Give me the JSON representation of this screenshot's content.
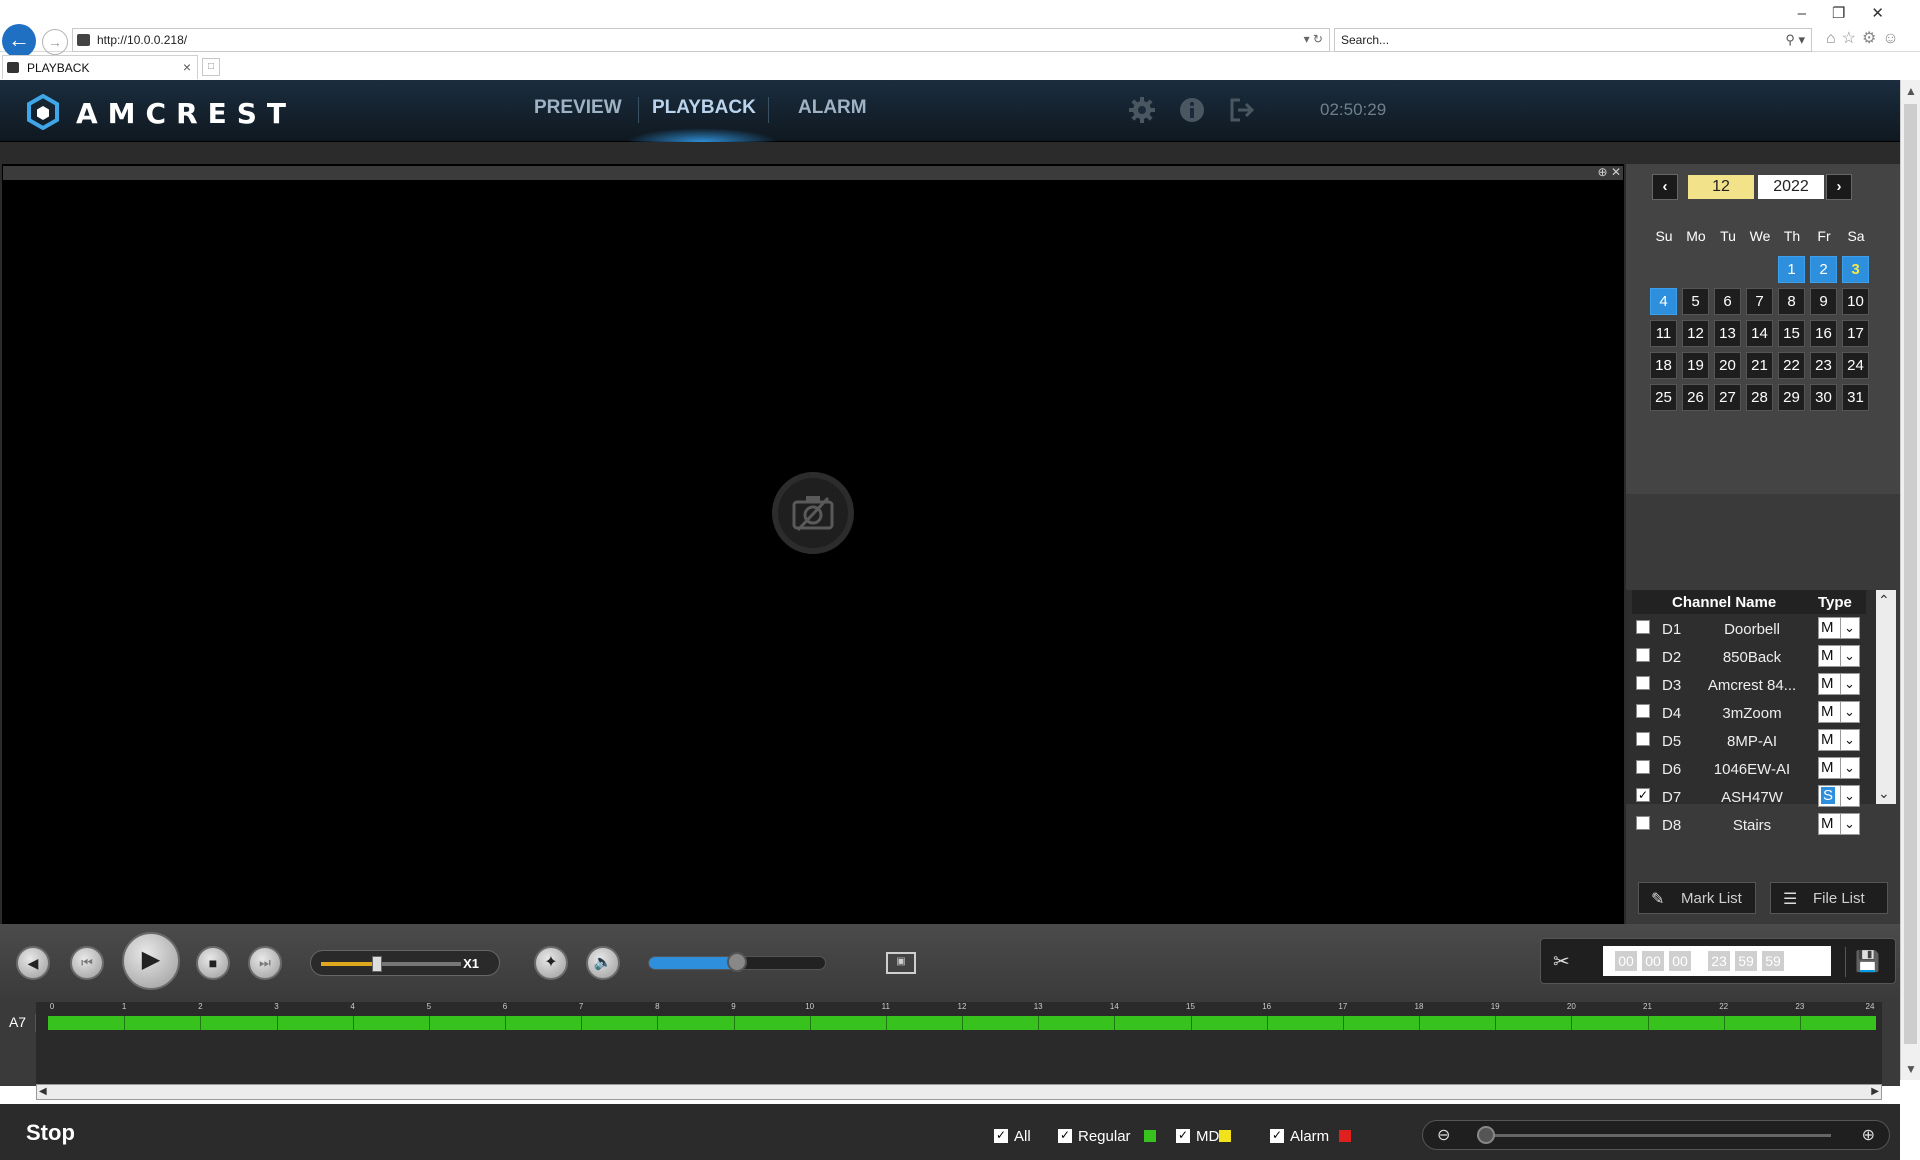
{
  "browser": {
    "url": "http://10.0.0.218/",
    "search_placeholder": "Search...",
    "tab_title": "PLAYBACK"
  },
  "header": {
    "logo_text": "AMCREST",
    "nav": [
      "PREVIEW",
      "PLAYBACK",
      "ALARM"
    ],
    "active_nav": "PLAYBACK",
    "clock": "02:50:29"
  },
  "calendar": {
    "month": "12",
    "year": "2022",
    "weekdays": [
      "Su",
      "Mo",
      "Tu",
      "We",
      "Th",
      "Fr",
      "Sa"
    ],
    "first_weekday_index": 4,
    "days_in_month": 31,
    "recorded_days": [
      1,
      2,
      3,
      4
    ],
    "today": 3
  },
  "channels": {
    "header_name": "Channel Name",
    "header_type": "Type",
    "rows": [
      {
        "id": "D1",
        "name": "Doorbell",
        "type": "M",
        "checked": false
      },
      {
        "id": "D2",
        "name": "850Back",
        "type": "M",
        "checked": false
      },
      {
        "id": "D3",
        "name": "Amcrest 84...",
        "type": "M",
        "checked": false
      },
      {
        "id": "D4",
        "name": "3mZoom",
        "type": "M",
        "checked": false
      },
      {
        "id": "D5",
        "name": "8MP-AI",
        "type": "M",
        "checked": false
      },
      {
        "id": "D6",
        "name": "1046EW-AI",
        "type": "M",
        "checked": false
      },
      {
        "id": "D7",
        "name": "ASH47W",
        "type": "S",
        "checked": true
      },
      {
        "id": "D8",
        "name": "Stairs",
        "type": "M",
        "checked": false
      }
    ]
  },
  "buttons": {
    "mark_list": "Mark List",
    "file_list": "File List"
  },
  "playback": {
    "speed_label": "X1",
    "speed_level": 0.4,
    "volume_level": 0.5
  },
  "clip": {
    "start": [
      "00",
      "00",
      "00"
    ],
    "end": [
      "23",
      "59",
      "59"
    ]
  },
  "timeline": {
    "channel": "A7",
    "hour_labels": [
      "0",
      "1",
      "2",
      "3",
      "4",
      "5",
      "6",
      "7",
      "8",
      "9",
      "10",
      "11",
      "12",
      "13",
      "14",
      "15",
      "16",
      "17",
      "18",
      "19",
      "20",
      "21",
      "22",
      "23",
      "24"
    ],
    "recorded_fraction": 1.0
  },
  "status": {
    "text": "Stop",
    "legend": [
      {
        "label": "All",
        "checked": true,
        "color": ""
      },
      {
        "label": "Regular",
        "checked": true,
        "color": "#37c21d"
      },
      {
        "label": "MD",
        "checked": true,
        "color": "#f2e21a"
      },
      {
        "label": "Alarm",
        "checked": true,
        "color": "#e01f1f"
      }
    ],
    "zoom_level": 0.0
  },
  "icons": {
    "settings": "gear-icon",
    "info": "info-icon",
    "logout": "logout-icon",
    "camera": "camera-off-icon"
  }
}
